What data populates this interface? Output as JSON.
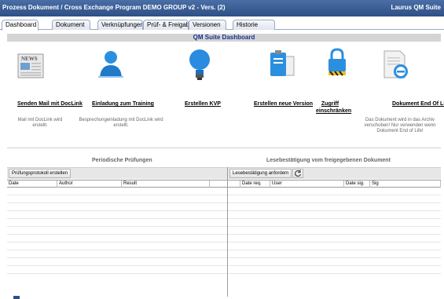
{
  "window": {
    "title": "Prozess Dokument / Cross Exchange Program DEMO GROUP v2 - Vers. (2)",
    "user": "Laurus QM Suite"
  },
  "tabs": [
    {
      "label": "Dashboard",
      "active": true
    },
    {
      "label": "Dokument"
    },
    {
      "label": "Verknüpfungen"
    },
    {
      "label": "Prüf- & Freigabe"
    },
    {
      "label": "Versionen"
    },
    {
      "label": "Historie"
    }
  ],
  "dashboard": {
    "header": "QM Suite Dashboard",
    "actions": [
      {
        "icon": "newspaper-icon",
        "label": "Senden Mail mit DocLink",
        "desc": "Mail mit DocLink wird erstellt."
      },
      {
        "icon": "person-icon",
        "label": "Einladung zum Training",
        "desc": "Besprechungeinladung mit DocLink wird erstellt."
      },
      {
        "icon": "lightbulb-icon",
        "label": "Erstellen KVP",
        "desc": ""
      },
      {
        "icon": "new-version-icon",
        "label": "Erstellen neue Version",
        "desc": ""
      },
      {
        "icon": "padlock-icon",
        "label": "Zugriff einschränken",
        "desc": ""
      },
      {
        "icon": "document-end-icon",
        "label": "Dokument End Of Life",
        "desc": "Das Dokument wird in das Archiv verschoben! Nur verwenden wenn Dokument End of Life!"
      }
    ]
  },
  "periodic": {
    "title": "Periodische Prüfungen",
    "button": "Prüfungsprotokoll erstellen",
    "columns": [
      "Date",
      "Author",
      "Result"
    ]
  },
  "reading": {
    "title": "Lesebestätigung vom freigegebenen Dokument",
    "button": "Lesebestätigung anfordern",
    "refresh_icon": "refresh-icon",
    "columns": [
      "Date req.",
      "User",
      "Date sig.",
      "Sig"
    ]
  },
  "colors": {
    "title_bar": "#2e4f86",
    "header_text": "#1a2f8f",
    "accent": "#2b8fe0"
  }
}
